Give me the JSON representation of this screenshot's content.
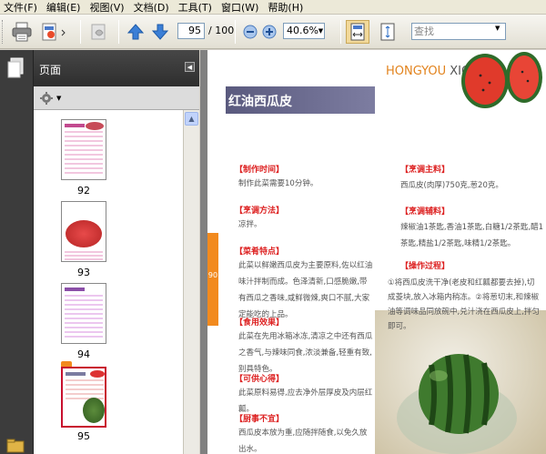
{
  "menu": [
    "文件(F)",
    "编辑(E)",
    "视图(V)",
    "文档(D)",
    "工具(T)",
    "窗口(W)",
    "帮助(H)"
  ],
  "toolbar": {
    "page_current": "95",
    "page_total": "/ 100",
    "zoom": "40.6%",
    "find_placeholder": "查找"
  },
  "panel": {
    "title": "页面",
    "thumbnails": [
      {
        "label": "92",
        "selected": false
      },
      {
        "label": "93",
        "selected": false
      },
      {
        "label": "94",
        "selected": false
      },
      {
        "label": "95",
        "selected": true
      }
    ]
  },
  "document": {
    "page_tab": "90",
    "brand_a": "HONGYOU",
    "brand_b": "XIGUAPI",
    "title": "红油西瓜皮",
    "left": [
      {
        "head": "【制作时间】",
        "body": "制作此菜需要10分钟。"
      },
      {
        "head": "【烹调方法】",
        "body": "凉拌。"
      },
      {
        "head": "【菜肴特点】",
        "body": "此菜以鲜嫩西瓜皮为主要原料,佐以红油味汁拌制而成。色泽清新,口感脆嫩,带有西瓜之香味,咸鲜微辣,爽口不腻,大家定能吃的上品。"
      },
      {
        "head": "【食用效果】",
        "body": "此菜在先用冰箱冰冻,清凉之中还有西瓜之香气,与辣味同食,浓淡兼备,轻重有致,别具特色。"
      },
      {
        "head": "【可供心得】",
        "body": "此菜原料易得,应去净外层厚皮及内层红瓤。"
      },
      {
        "head": "【厨事不宜】",
        "body": "西瓜皮本放为重,应随拌随食,以免久放出水。"
      }
    ],
    "right": [
      {
        "head": "【烹调主料】",
        "body": "西瓜皮(肉厚)750克,葱20克。"
      },
      {
        "head": "【烹调辅料】",
        "body": "辣椒油1茶匙,香油1茶匙,白糖1/2茶匙,醋1茶匙,精盐1/2茶匙,味精1/2茶匙。"
      },
      {
        "head": "【操作过程】",
        "body": "①将西瓜皮洗干净(老皮和红瓤都要去掉),切成菱块,放入冰箱内稍冻。②将葱切末,和辣椒油等调味品同放碗中,兑汁浇在西瓜皮上,拌匀即可。"
      }
    ]
  }
}
